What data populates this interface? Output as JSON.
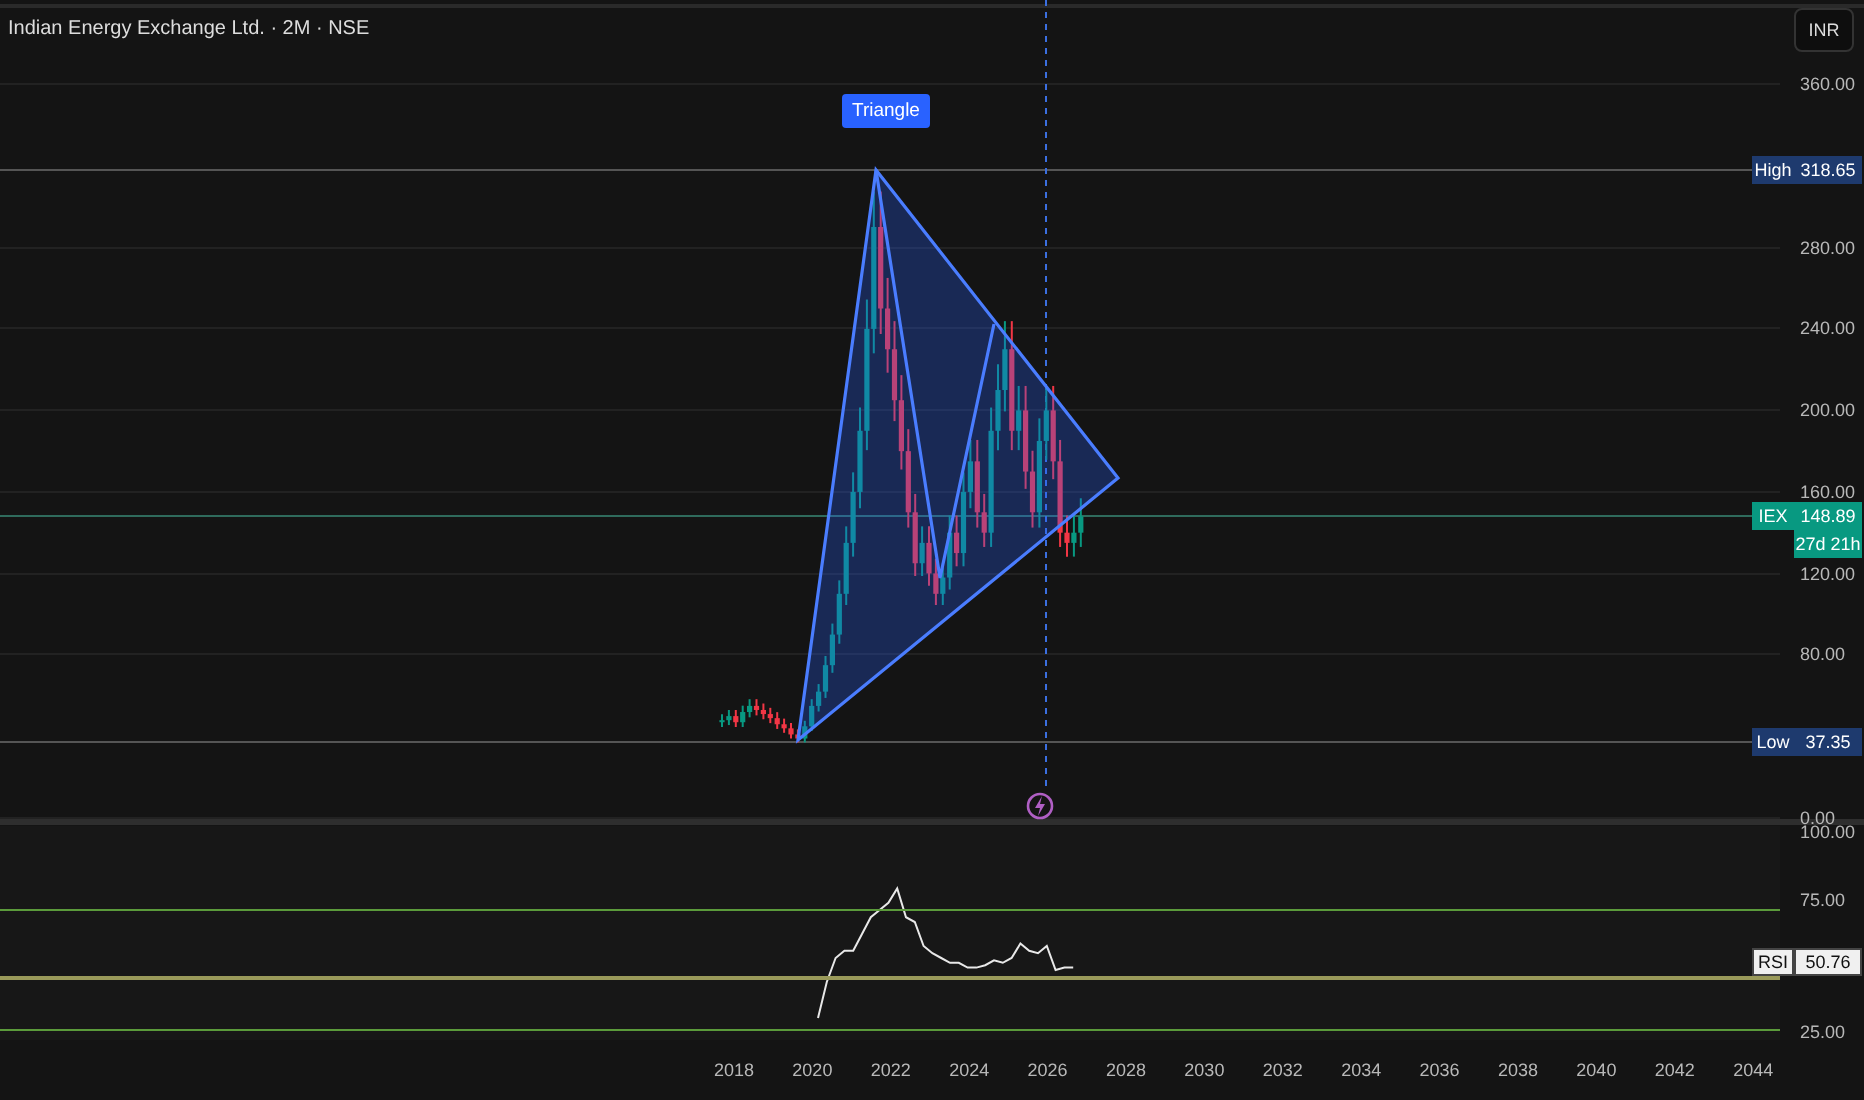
{
  "header": {
    "title": "Indian Energy Exchange Ltd. · 2M · NSE",
    "currency_button": "INR"
  },
  "price_axis": {
    "ticks": [
      "360.00",
      "280.00",
      "240.00",
      "200.00",
      "160.00",
      "120.00",
      "80.00",
      "0.00"
    ]
  },
  "markers": [
    {
      "kind": "high",
      "label": "High",
      "value": "318.65"
    },
    {
      "kind": "symbol",
      "label": "IEX",
      "value": "148.89",
      "countdown": "27d 21h"
    },
    {
      "kind": "low",
      "label": "Low",
      "value": "37.35"
    }
  ],
  "pattern": {
    "label": "Triangle"
  },
  "rsi": {
    "label": "RSI",
    "value": "50.76",
    "ticks": [
      "100.00",
      "75.00",
      "25.00"
    ]
  },
  "time_axis": {
    "ticks": [
      "2018",
      "2020",
      "2022",
      "2024",
      "2026",
      "2028",
      "2030",
      "2032",
      "2034",
      "2036",
      "2038",
      "2040",
      "2042",
      "2044"
    ]
  }
}
